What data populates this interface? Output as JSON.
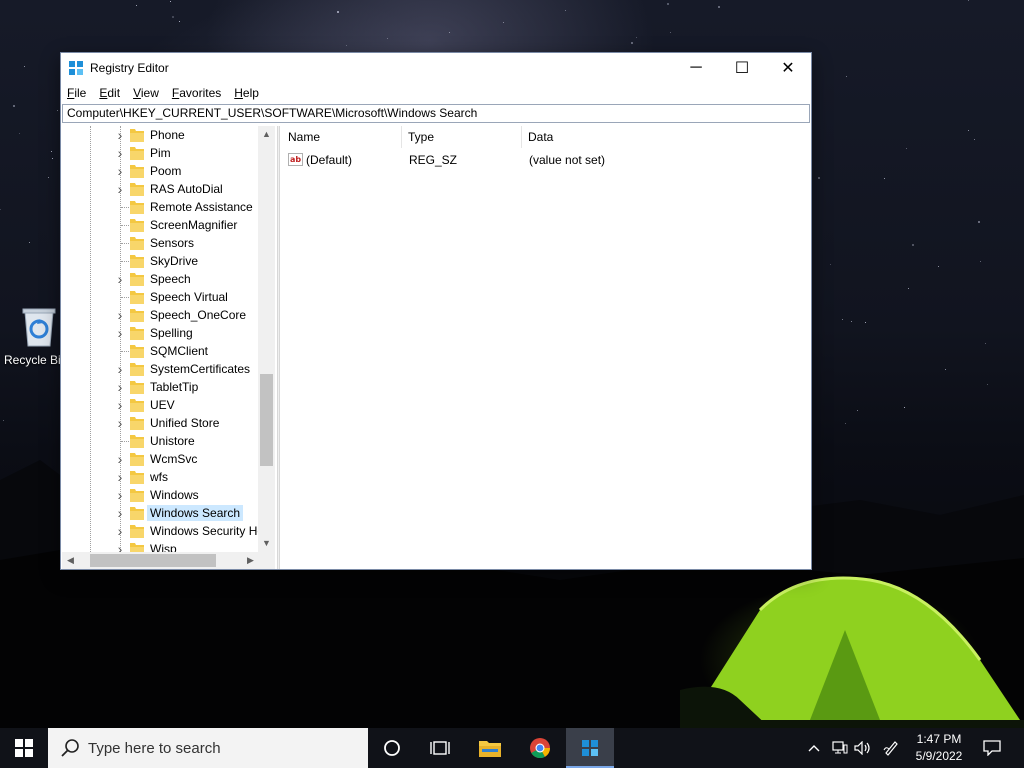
{
  "desktop": {
    "icons": [
      {
        "label": "Recycle Bin",
        "icon": "recycle-bin-icon"
      }
    ]
  },
  "window": {
    "title": "Registry Editor",
    "controls": {
      "minimize": "─",
      "maximize": "☐",
      "close": "✕"
    },
    "menu": [
      "File",
      "Edit",
      "View",
      "Favorites",
      "Help"
    ],
    "address": "Computer\\HKEY_CURRENT_USER\\SOFTWARE\\Microsoft\\Windows Search",
    "tree": {
      "items": [
        {
          "label": "Phone",
          "expandable": true
        },
        {
          "label": "Pim",
          "expandable": true
        },
        {
          "label": "Poom",
          "expandable": true
        },
        {
          "label": "RAS AutoDial",
          "expandable": true
        },
        {
          "label": "Remote Assistance",
          "expandable": false
        },
        {
          "label": "ScreenMagnifier",
          "expandable": false
        },
        {
          "label": "Sensors",
          "expandable": false
        },
        {
          "label": "SkyDrive",
          "expandable": false
        },
        {
          "label": "Speech",
          "expandable": true
        },
        {
          "label": "Speech Virtual",
          "expandable": false
        },
        {
          "label": "Speech_OneCore",
          "expandable": true
        },
        {
          "label": "Spelling",
          "expandable": true
        },
        {
          "label": "SQMClient",
          "expandable": false
        },
        {
          "label": "SystemCertificates",
          "expandable": true
        },
        {
          "label": "TabletTip",
          "expandable": true
        },
        {
          "label": "UEV",
          "expandable": true
        },
        {
          "label": "Unified Store",
          "expandable": true
        },
        {
          "label": "Unistore",
          "expandable": false
        },
        {
          "label": "WcmSvc",
          "expandable": true
        },
        {
          "label": "wfs",
          "expandable": true
        },
        {
          "label": "Windows",
          "expandable": true
        },
        {
          "label": "Windows Search",
          "expandable": true,
          "selected": true
        },
        {
          "label": "Windows Security Health",
          "expandable": true
        },
        {
          "label": "Wisp",
          "expandable": true
        }
      ],
      "selected_color": "#cce8ff",
      "folder_color": "#f4c842"
    },
    "values": {
      "columns": [
        "Name",
        "Type",
        "Data"
      ],
      "rows": [
        {
          "icon": "string-value-icon",
          "icon_text": "ab",
          "name": "(Default)",
          "type": "REG_SZ",
          "data": "(value not set)"
        }
      ]
    }
  },
  "taskbar": {
    "search_placeholder": "Type here to search",
    "pinned": [
      {
        "name": "cortana-icon"
      },
      {
        "name": "task-view-icon"
      },
      {
        "name": "file-explorer-icon"
      },
      {
        "name": "chrome-icon"
      },
      {
        "name": "registry-editor-icon",
        "active": true
      }
    ],
    "tray": [
      "chevron-up-icon",
      "network-icon",
      "volume-icon",
      "pen-icon"
    ],
    "time": "1:47 PM",
    "date": "5/9/2022",
    "accent": "#7aa7e8"
  }
}
